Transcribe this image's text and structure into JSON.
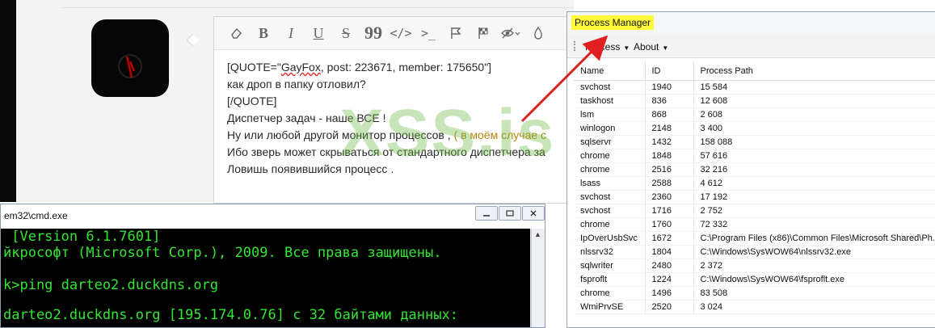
{
  "editor": {
    "toolbar": {
      "eraser": "eraser-icon",
      "bold": "B",
      "italic": "I",
      "underline": "U",
      "strike": "S",
      "quote": "99",
      "code": "</>",
      "terminal": ">_"
    },
    "lines": [
      {
        "pre": "[QUOTE=\"",
        "sq": "GayFox",
        "post": ", post: 223671, member: 175650\"]"
      },
      {
        "text": "как дроп в папку отловил?"
      },
      {
        "text": "[/QUOTE]"
      },
      {
        "text": "Диспетчер задач - наше ВСЕ !"
      },
      {
        "text": "Ну или любой другой монитор процессов , ",
        "faint": "( в моём случае с"
      },
      {
        "text": "Ибо зверь может скрываться от стандартного диспетчера за"
      },
      {
        "text": "Ловишь появившийся процесс ."
      }
    ]
  },
  "watermark": "XSS.is",
  "cmd": {
    "title": "em32\\cmd.exe",
    "lines": [
      " [Version 6.1.7601]",
      "йкрософт (Microsoft Corp.), 2009. Все права защищены.",
      "",
      "k>ping darteo2.duckdns.org",
      "",
      "darteo2.duckdns.org [195.174.0.76] с 32 байтами данных:"
    ]
  },
  "process_manager": {
    "title": "Process Manager",
    "menu": [
      "Process",
      "About"
    ],
    "columns": [
      "Name",
      "ID",
      "Process Path"
    ],
    "rows": [
      [
        "svchost",
        "1940",
        "15 584"
      ],
      [
        "taskhost",
        "836",
        "12 608"
      ],
      [
        "lsm",
        "868",
        "2 608"
      ],
      [
        "winlogon",
        "2148",
        "3 400"
      ],
      [
        "sqlservr",
        "1432",
        "158 088"
      ],
      [
        "chrome",
        "1848",
        "57 616"
      ],
      [
        "chrome",
        "2516",
        "32 216"
      ],
      [
        "lsass",
        "2588",
        "4 612"
      ],
      [
        "svchost",
        "2360",
        "17 192"
      ],
      [
        "svchost",
        "1716",
        "2 752"
      ],
      [
        "chrome",
        "1760",
        "72 332"
      ],
      [
        "IpOverUsbSvc",
        "1672",
        "C:\\Program Files (x86)\\Common Files\\Microsoft Shared\\Ph..."
      ],
      [
        "nlssrv32",
        "1804",
        "C:\\Windows\\SysWOW64\\nlssrv32.exe"
      ],
      [
        "sqlwriter",
        "2480",
        "2 372"
      ],
      [
        "fsproflt",
        "1224",
        "C:\\Windows\\SysWOW64\\fsproflt.exe"
      ],
      [
        "chrome",
        "1496",
        "83 508"
      ],
      [
        "WmiPrvSE",
        "2520",
        "3 024"
      ]
    ]
  },
  "colors": {
    "highlight_box": "#c01010",
    "title_highlight": "#fffb3a",
    "terminal_text": "#33e533",
    "arrow": "#e02020"
  }
}
